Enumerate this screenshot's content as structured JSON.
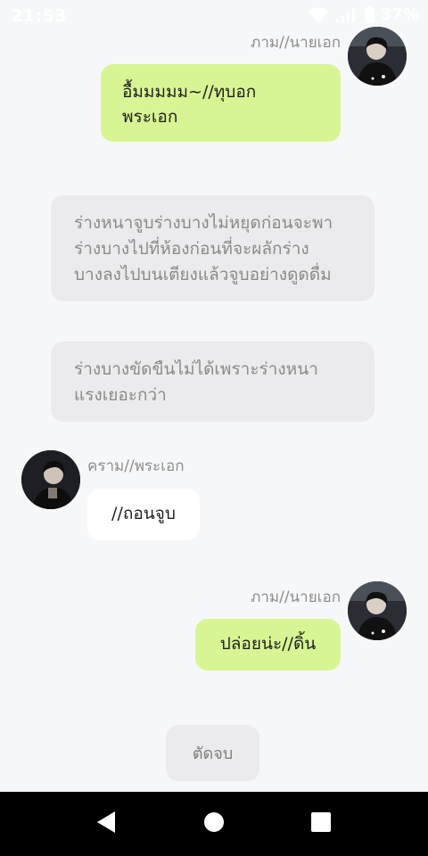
{
  "status_bar": {
    "time": "21:53",
    "battery": "37%"
  },
  "messages": [
    {
      "sender": "ภาม//นายเอก",
      "text": "อื้มมมมม~//ทุบอก\nพระเอก",
      "side": "right"
    },
    {
      "narration": "ร่างหนาจูบร่างบางไม่หยุดก่อนจะพา\nร่างบางไปที่ห้องก่อนที่จะผลักร่าง\nบางลงไปบนเตียงแล้วจูบอย่างดูดดื่ม"
    },
    {
      "narration": "ร่างบางขัดขืนไม่ได้เพราะร่างหนา\nแรงเยอะกว่า"
    },
    {
      "sender": "คราม//พระเอก",
      "text": "//ถอนจูบ",
      "side": "left"
    },
    {
      "sender": "ภาม//นายเอก",
      "text": "ปล่อยน่ะ//ดิ้น",
      "side": "right"
    }
  ],
  "action_button": {
    "label": "ตัดจบ"
  },
  "colors": {
    "background": "#f6f7f9",
    "right_bubble": "#d7f593",
    "left_bubble": "#ffffff",
    "narration_bubble": "#ebebed",
    "nav_bar": "#000000"
  },
  "icons": {
    "status": [
      "wifi-icon",
      "signal-icon",
      "battery-icon"
    ],
    "navigation": [
      "back-icon",
      "home-icon",
      "recents-icon"
    ]
  }
}
